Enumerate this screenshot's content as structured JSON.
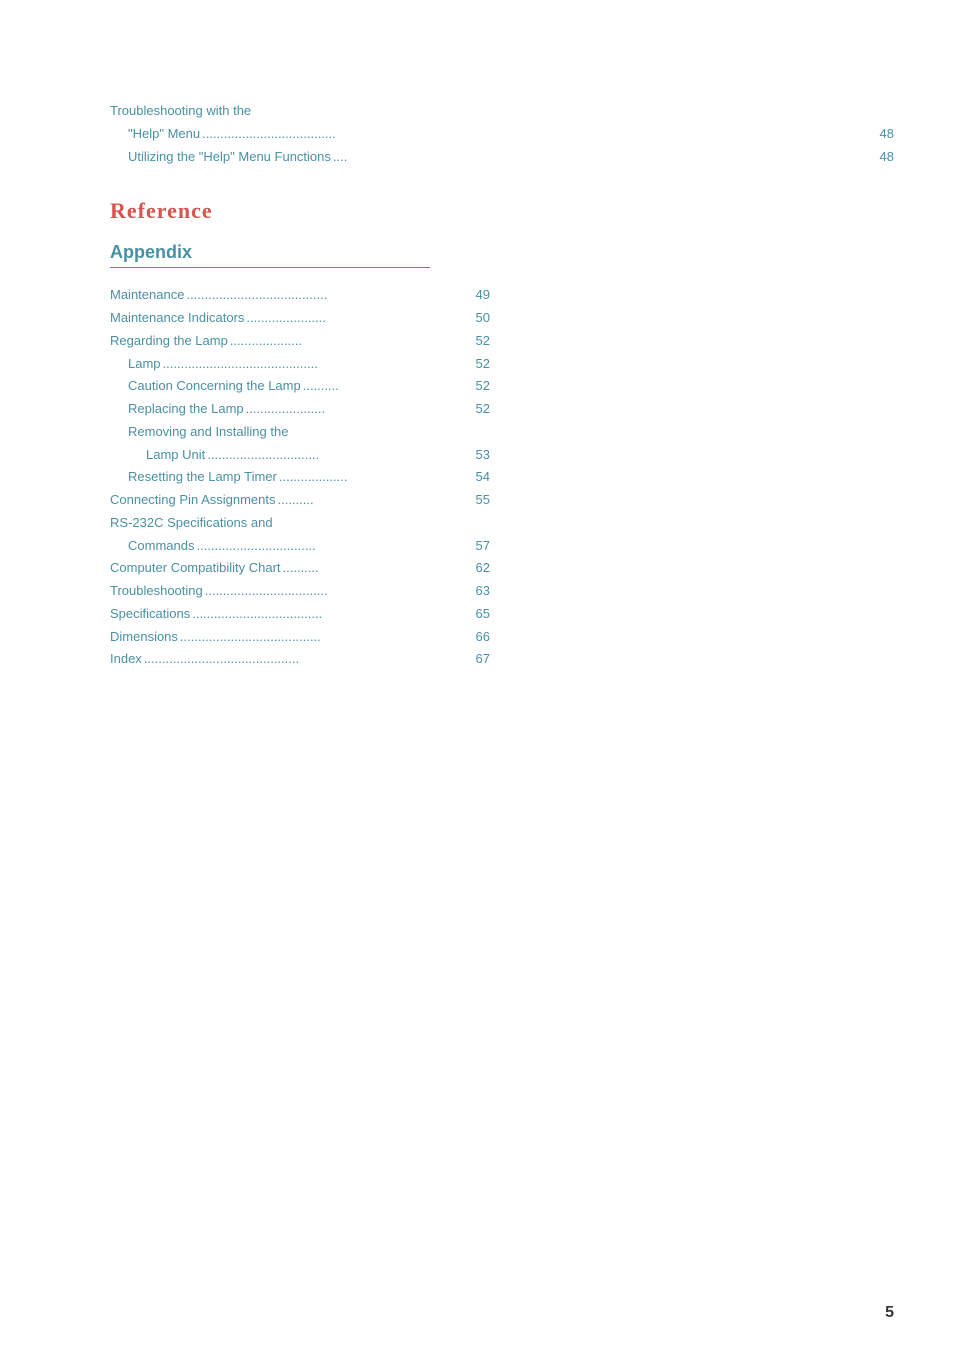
{
  "troubleshooting_section": {
    "label": "Troubleshooting with the",
    "items": [
      {
        "label": "\"Help\" Menu",
        "dots": ".....................................",
        "page": "48"
      },
      {
        "label": "Utilizing the \"Help\" Menu Functions",
        "dots": "....",
        "page": "48"
      }
    ]
  },
  "reference_heading": "Reference",
  "appendix_heading": "Appendix",
  "toc_items": [
    {
      "label": "Maintenance",
      "dots": ".......................................",
      "page": "49",
      "indent": 0
    },
    {
      "label": "Maintenance Indicators",
      "dots": "......................",
      "page": "50",
      "indent": 0
    },
    {
      "label": "Regarding the Lamp",
      "dots": "....................",
      "page": "52",
      "indent": 0
    },
    {
      "label": "Lamp",
      "dots": "...........................................",
      "page": "52",
      "indent": 1
    },
    {
      "label": "Caution Concerning the Lamp",
      "dots": "..........",
      "page": "52",
      "indent": 1
    },
    {
      "label": "Replacing the Lamp",
      "dots": "......................",
      "page": "52",
      "indent": 1
    },
    {
      "label": "Removing and Installing the",
      "dots": "",
      "page": "",
      "indent": 1
    },
    {
      "label": "Lamp Unit",
      "dots": "...............................",
      "page": "53",
      "indent": 2
    },
    {
      "label": "Resetting the Lamp Timer",
      "dots": "...................",
      "page": "54",
      "indent": 1
    },
    {
      "label": "Connecting Pin Assignments",
      "dots": "..........",
      "page": "55",
      "indent": 0
    },
    {
      "label": "RS-232C Specifications and",
      "dots": "",
      "page": "",
      "indent": 0
    },
    {
      "label": "Commands",
      "dots": ".................................",
      "page": "57",
      "indent": 1
    },
    {
      "label": "Computer Compatibility Chart",
      "dots": "..........",
      "page": "62",
      "indent": 0
    },
    {
      "label": "Troubleshooting",
      "dots": "..................................",
      "page": "63",
      "indent": 0
    },
    {
      "label": "Specifications",
      "dots": "....................................",
      "page": "65",
      "indent": 0
    },
    {
      "label": "Dimensions",
      "dots": ".......................................",
      "page": "66",
      "indent": 0
    },
    {
      "label": "Index",
      "dots": "...........................................",
      "page": "67",
      "indent": 0
    }
  ],
  "page_number": "5"
}
